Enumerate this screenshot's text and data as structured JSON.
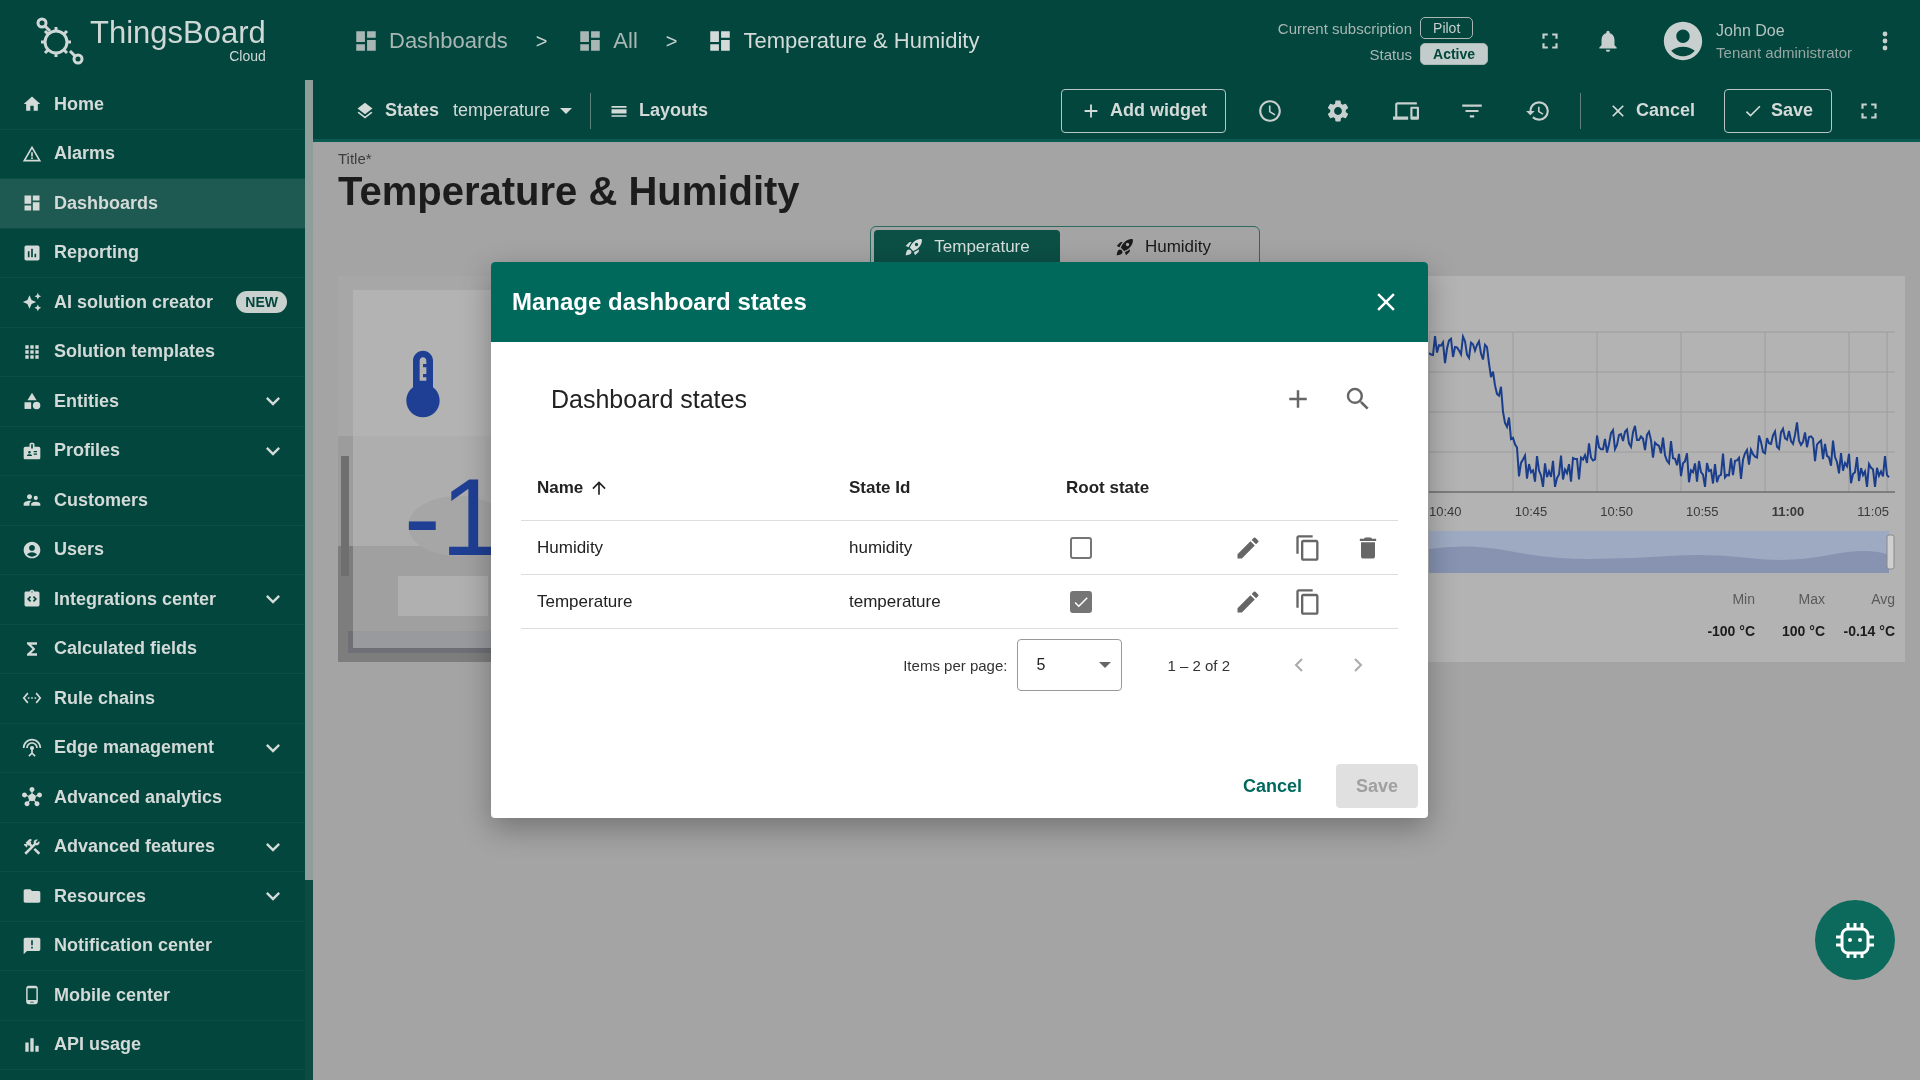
{
  "logo": {
    "name": "ThingsBoard",
    "edition": "Cloud"
  },
  "breadcrumbs": [
    {
      "label": "Dashboards"
    },
    {
      "separator": ">",
      "label": "All"
    },
    {
      "separator": ">",
      "label": "Temperature & Humidity"
    }
  ],
  "subscription": {
    "label": "Current subscription",
    "plan": "Pilot",
    "status_label": "Status",
    "status": "Active"
  },
  "user": {
    "name": "John Doe",
    "role": "Tenant administrator"
  },
  "sidebar": {
    "items": [
      {
        "label": "Home",
        "selected": false,
        "expandable": false
      },
      {
        "label": "Alarms",
        "selected": false,
        "expandable": false
      },
      {
        "label": "Dashboards",
        "selected": true,
        "expandable": false
      },
      {
        "label": "Reporting",
        "selected": false,
        "expandable": false
      },
      {
        "label": "AI solution creator",
        "selected": false,
        "expandable": false,
        "badge": "NEW"
      },
      {
        "label": "Solution templates",
        "selected": false,
        "expandable": false
      },
      {
        "label": "Entities",
        "selected": false,
        "expandable": true
      },
      {
        "label": "Profiles",
        "selected": false,
        "expandable": true
      },
      {
        "label": "Customers",
        "selected": false,
        "expandable": false
      },
      {
        "label": "Users",
        "selected": false,
        "expandable": false
      },
      {
        "label": "Integrations center",
        "selected": false,
        "expandable": true
      },
      {
        "label": "Calculated fields",
        "selected": false,
        "expandable": false
      },
      {
        "label": "Rule chains",
        "selected": false,
        "expandable": false
      },
      {
        "label": "Edge management",
        "selected": false,
        "expandable": true
      },
      {
        "label": "Advanced analytics",
        "selected": false,
        "expandable": false
      },
      {
        "label": "Advanced features",
        "selected": false,
        "expandable": true
      },
      {
        "label": "Resources",
        "selected": false,
        "expandable": true
      },
      {
        "label": "Notification center",
        "selected": false,
        "expandable": false
      },
      {
        "label": "Mobile center",
        "selected": false,
        "expandable": false
      },
      {
        "label": "API usage",
        "selected": false,
        "expandable": false
      }
    ]
  },
  "toolbar": {
    "states_label": "States",
    "state_value": "temperature",
    "layouts_label": "Layouts",
    "add_widget": "Add widget",
    "cancel": "Cancel",
    "save": "Save"
  },
  "dashboard": {
    "title_label": "Title*",
    "title": "Temperature & Humidity",
    "state_tabs": [
      {
        "label": "Temperature",
        "selected": true
      },
      {
        "label": "Humidity",
        "selected": false
      }
    ],
    "value_widget": {
      "kind": "picture",
      "value": "-1"
    },
    "chart_widget": {
      "time_labels": [
        {
          "label": "10:40",
          "major": false
        },
        {
          "label": "10:45",
          "major": false
        },
        {
          "label": "10:50",
          "major": false
        },
        {
          "label": "10:55",
          "major": false
        },
        {
          "label": "11:00",
          "major": true
        },
        {
          "label": "11:05",
          "major": false
        }
      ],
      "stats": [
        {
          "label": "Min",
          "value": "-100 °C"
        },
        {
          "label": "Max",
          "value": "100 °C"
        },
        {
          "label": "Avg",
          "value": "-0.14 °C"
        }
      ]
    }
  },
  "dialog": {
    "title": "Manage dashboard states",
    "table_title": "Dashboard states",
    "columns": [
      {
        "label": "Name",
        "sorted": true
      },
      {
        "label": "State Id",
        "sorted": false
      },
      {
        "label": "Root state",
        "sorted": false
      }
    ],
    "rows": [
      {
        "name": "Humidity",
        "state_id": "humidity",
        "root": false,
        "deletable": true
      },
      {
        "name": "Temperature",
        "state_id": "temperature",
        "root": true,
        "deletable": false
      }
    ],
    "pagination": {
      "label": "Items per page:",
      "page_size": "5",
      "range": "1 – 2 of 2"
    },
    "cancel": "Cancel",
    "save": {
      "label": "Save",
      "disabled": true
    }
  }
}
